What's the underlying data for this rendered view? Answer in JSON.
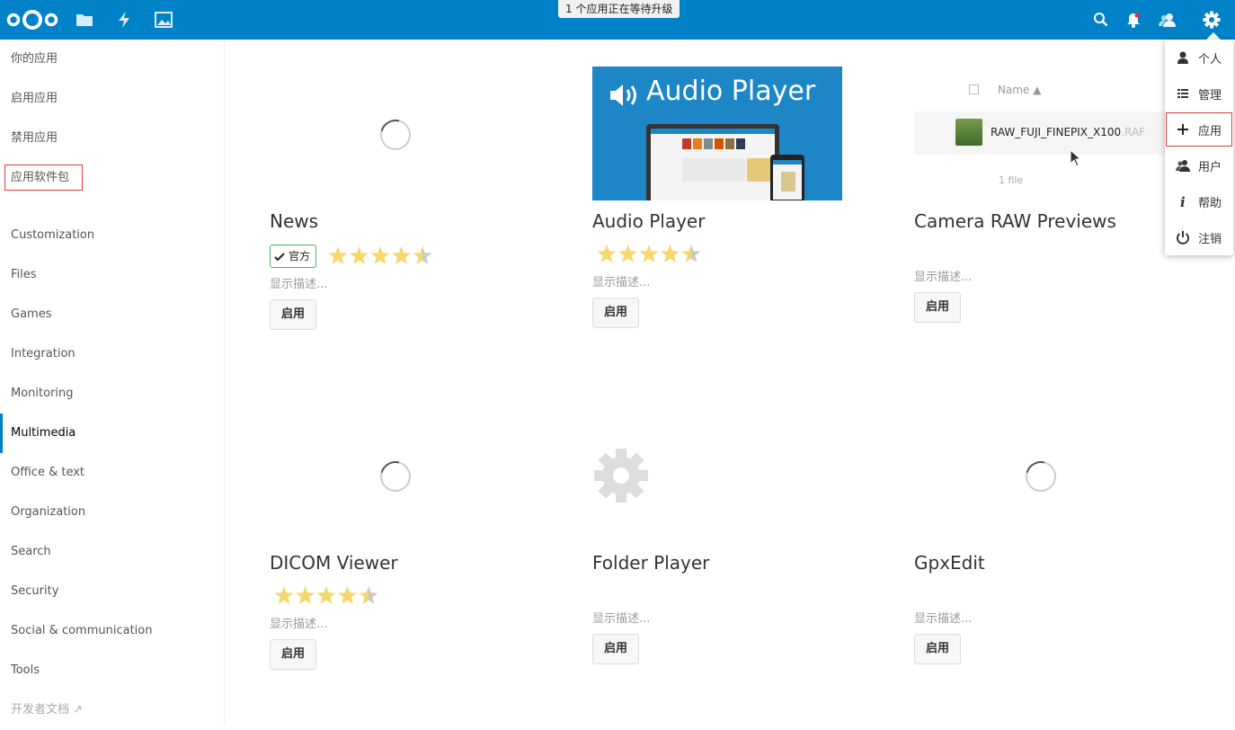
{
  "header": {
    "update_notice": "1 个应用正在等待升级",
    "brand_color": "#0082c9",
    "left_icons": [
      "nextcloud-logo-icon",
      "files-icon",
      "activity-icon",
      "gallery-icon"
    ],
    "right_icons": [
      "search-icon",
      "notifications-icon",
      "contacts-icon",
      "settings-icon"
    ]
  },
  "sidebar": {
    "items": [
      {
        "label": "你的应用"
      },
      {
        "label": "启用应用"
      },
      {
        "label": "禁用应用"
      },
      {
        "label": "应用软件包"
      },
      {
        "label": "Customization"
      },
      {
        "label": "Files"
      },
      {
        "label": "Games"
      },
      {
        "label": "Integration"
      },
      {
        "label": "Monitoring"
      },
      {
        "label": "Multimedia"
      },
      {
        "label": "Office & text"
      },
      {
        "label": "Organization"
      },
      {
        "label": "Search"
      },
      {
        "label": "Security"
      },
      {
        "label": "Social & communication"
      },
      {
        "label": "Tools"
      },
      {
        "label": "开发者文档 ↗"
      }
    ],
    "active_item": "Multimedia"
  },
  "apps": [
    {
      "name": "News",
      "official_badge": "官方",
      "rating": 4.5,
      "description": "显示描述...",
      "enable_label": "启用",
      "preview": "loading-spinner"
    },
    {
      "name": "Audio Player",
      "rating": 4.5,
      "description": "显示描述...",
      "enable_label": "启用",
      "preview": "banner"
    },
    {
      "name": "Camera RAW Previews",
      "description": "显示描述...",
      "enable_label": "启用",
      "preview": "file-list"
    },
    {
      "name": "DICOM Viewer",
      "rating": 4.5,
      "description": "显示描述...",
      "enable_label": "启用",
      "preview": "loading-spinner"
    },
    {
      "name": "Folder Player",
      "description": "显示描述...",
      "enable_label": "启用",
      "preview": "gear-icon"
    },
    {
      "name": "GpxEdit",
      "description": "显示描述...",
      "enable_label": "启用",
      "preview": "loading-spinner"
    }
  ],
  "audio_banner": {
    "title": "Audio Player"
  },
  "raw_preview": {
    "column_header": "Name ▲",
    "file_name": "RAW_FUJI_FINEPIX_X100",
    "file_ext": ".RAF",
    "file_count": "1 file"
  },
  "settings_menu": {
    "items": [
      {
        "label": "个人",
        "icon": "user-icon"
      },
      {
        "label": "管理",
        "icon": "admin-list-icon"
      },
      {
        "label": "应用",
        "icon": "plus-icon"
      },
      {
        "label": "用户",
        "icon": "users-icon"
      },
      {
        "label": "帮助",
        "icon": "info-icon"
      },
      {
        "label": "注销",
        "icon": "power-icon"
      }
    ]
  },
  "colors": {
    "official_badge_border": "#46ba61",
    "star_fill": "#f5d76e",
    "star_empty": "#c9c9c9",
    "highlight_box": "#e23a3a"
  }
}
